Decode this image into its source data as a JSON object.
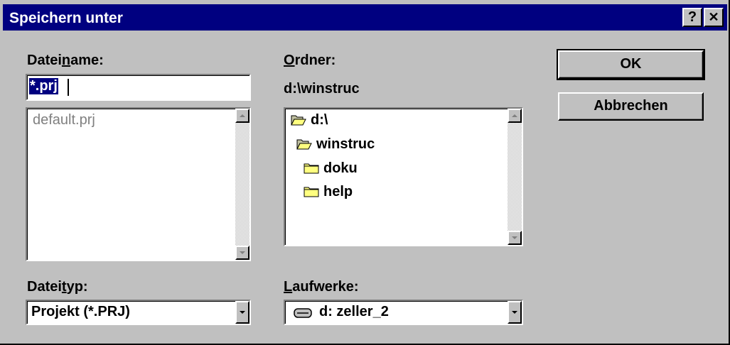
{
  "title": "Speichern unter",
  "title_buttons": {
    "help": "?",
    "close": "✕"
  },
  "filename": {
    "label_pre": "Datei",
    "label_u": "n",
    "label_post": "ame:",
    "value": "*.prj",
    "files": [
      "default.prj"
    ]
  },
  "folder": {
    "label_u": "O",
    "label_post": "rdner:",
    "path": "d:\\winstruc",
    "tree": [
      {
        "name": "d:\\",
        "icon": "open-folder-icon"
      },
      {
        "name": "winstruc",
        "icon": "open-folder-icon"
      },
      {
        "name": "doku",
        "icon": "folder-icon"
      },
      {
        "name": "help",
        "icon": "folder-icon"
      }
    ]
  },
  "filetype": {
    "label_pre": "Datei",
    "label_u": "t",
    "label_post": "yp:",
    "value": "Projekt (*.PRJ)"
  },
  "drives": {
    "label_u": "L",
    "label_post": "aufwerke:",
    "value": "d: zeller_2",
    "icon": "drive-icon"
  },
  "buttons": {
    "ok": "OK",
    "cancel": "Abbrechen"
  },
  "colors": {
    "titlebar": "#000080",
    "face": "#c0c0c0",
    "selection": "#000080",
    "folder": "#ffff80"
  }
}
